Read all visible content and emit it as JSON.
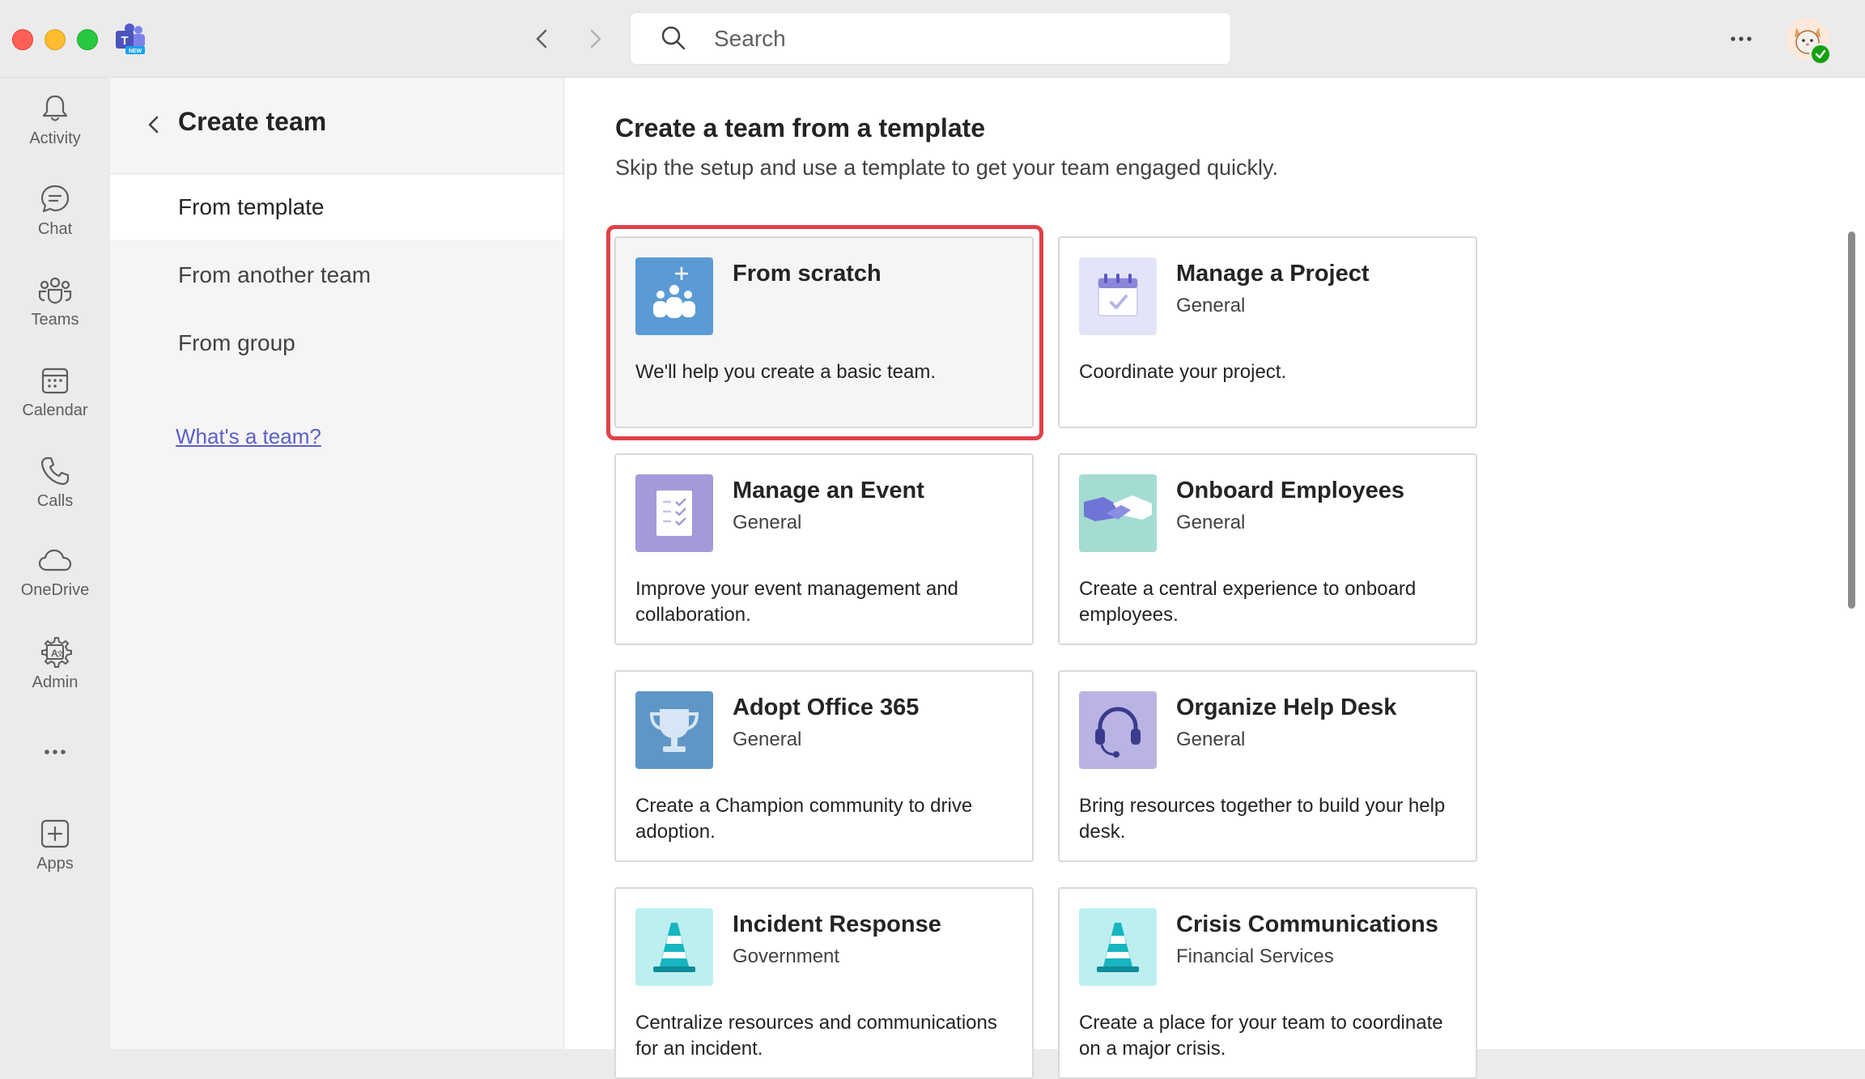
{
  "titlebar": {
    "search_placeholder": "Search",
    "more_icon": "more-horizontal-icon"
  },
  "rail": {
    "items": [
      {
        "label": "Activity",
        "icon": "bell-icon"
      },
      {
        "label": "Chat",
        "icon": "chat-icon"
      },
      {
        "label": "Teams",
        "icon": "teams-icon"
      },
      {
        "label": "Calendar",
        "icon": "calendar-icon"
      },
      {
        "label": "Calls",
        "icon": "phone-icon"
      },
      {
        "label": "OneDrive",
        "icon": "cloud-icon"
      },
      {
        "label": "Admin",
        "icon": "admin-icon"
      },
      {
        "label": "Apps",
        "icon": "add-app-icon"
      }
    ]
  },
  "leftpane": {
    "title": "Create team",
    "menu": [
      {
        "label": "From template",
        "selected": true
      },
      {
        "label": "From another team",
        "selected": false
      },
      {
        "label": "From group",
        "selected": false
      }
    ],
    "help_link": "What's a team?"
  },
  "main": {
    "title": "Create a team from a template",
    "subtitle": "Skip the setup and use a template to get your team engaged quickly.",
    "templates": [
      {
        "name": "From scratch",
        "category": "",
        "description": "We'll help you create a basic team.",
        "icon": "people-add-icon",
        "color": "#5b9bd5",
        "highlighted": true
      },
      {
        "name": "Manage a Project",
        "category": "General",
        "description": "Coordinate your project.",
        "icon": "calendar-check-icon",
        "color": "#e4e4f8"
      },
      {
        "name": "Manage an Event",
        "category": "General",
        "description": "Improve your event management and collaboration.",
        "icon": "checklist-icon",
        "color": "#a49ad8"
      },
      {
        "name": "Onboard Employees",
        "category": "General",
        "description": "Create a central experience to onboard employees.",
        "icon": "handshake-icon",
        "color": "#a4dcd2"
      },
      {
        "name": "Adopt Office 365",
        "category": "General",
        "description": "Create a Champion community to drive adoption.",
        "icon": "trophy-icon",
        "color": "#6096c6"
      },
      {
        "name": "Organize Help Desk",
        "category": "General",
        "description": "Bring resources together to build your help desk.",
        "icon": "headset-icon",
        "color": "#b9b4e4"
      },
      {
        "name": "Incident Response",
        "category": "Government",
        "description": "Centralize resources and communications for an incident.",
        "icon": "traffic-cone-icon",
        "color": "#bdeff0"
      },
      {
        "name": "Crisis Communications",
        "category": "Financial Services",
        "description": "Create a place for your team to coordinate on a major crisis.",
        "icon": "traffic-cone-icon",
        "color": "#bdeff0"
      }
    ]
  },
  "colors": {
    "accent": "#5b5fc7",
    "highlight": "#e0424a",
    "presence": "#13a10e"
  }
}
